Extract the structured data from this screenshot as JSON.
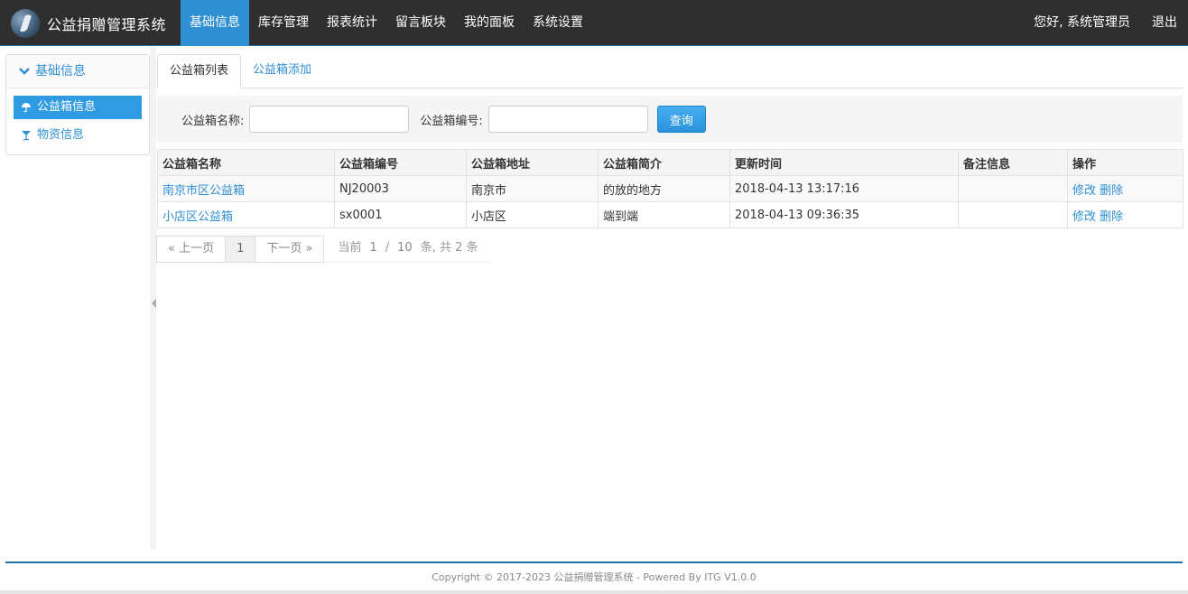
{
  "app": {
    "title": "公益捐赠管理系统"
  },
  "nav": {
    "items": [
      {
        "label": "基础信息",
        "active": true
      },
      {
        "label": "库存管理"
      },
      {
        "label": "报表统计"
      },
      {
        "label": "留言板块"
      },
      {
        "label": "我的面板"
      },
      {
        "label": "系统设置"
      }
    ],
    "greeting": "您好, 系统管理员",
    "logout": "退出"
  },
  "sidebar": {
    "header": "基础信息",
    "items": [
      {
        "label": "公益箱信息",
        "icon": "umbrella-icon",
        "active": true
      },
      {
        "label": "物资信息",
        "icon": "glass-icon"
      }
    ]
  },
  "tabs": [
    {
      "label": "公益箱列表",
      "active": true
    },
    {
      "label": "公益箱添加"
    }
  ],
  "search": {
    "name_label": "公益箱名称:",
    "name_value": "",
    "code_label": "公益箱编号:",
    "code_value": "",
    "button": "查询"
  },
  "table": {
    "columns": [
      "公益箱名称",
      "公益箱编号",
      "公益箱地址",
      "公益箱简介",
      "更新时间",
      "备注信息",
      "操作"
    ],
    "rows": [
      {
        "name": "南京市区公益箱",
        "code": "NJ20003",
        "address": "南京市",
        "intro": "的放的地方",
        "updated": "2018-04-13 13:17:16",
        "remark": "",
        "edit": "修改",
        "delete": "删除"
      },
      {
        "name": "小店区公益箱",
        "code": "sx0001",
        "address": "小店区",
        "intro": "端到端",
        "updated": "2018-04-13 09:36:35",
        "remark": "",
        "edit": "修改",
        "delete": "删除"
      }
    ]
  },
  "pager": {
    "prev": "« 上一页",
    "current": "1",
    "next": "下一页 »",
    "info_current_label": "当前",
    "info_page": "1",
    "info_sep": "/",
    "info_size": "10",
    "info_tail": "条, 共 2 条"
  },
  "footer": {
    "text": "Copyright © 2017-2023 公益捐赠管理系统 - Powered By ITG V1.0.0"
  }
}
